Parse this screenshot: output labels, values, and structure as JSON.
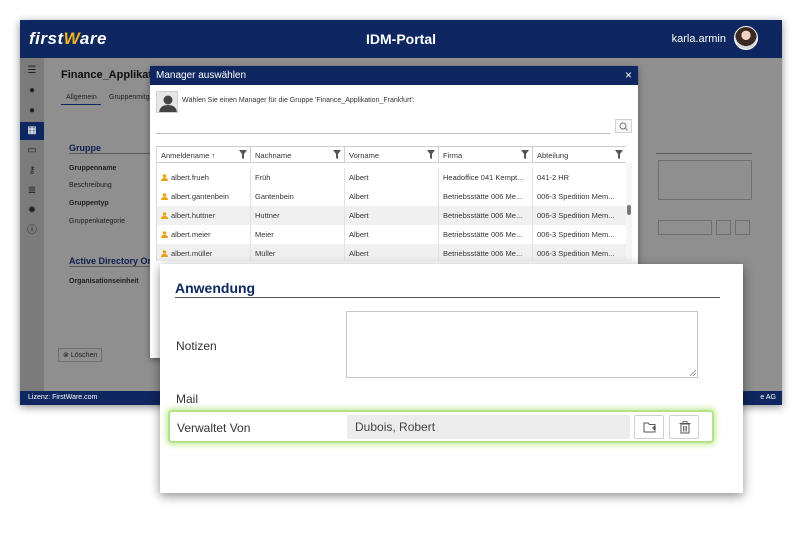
{
  "app": {
    "logo_text_a": "first",
    "logo_text_w": "W",
    "logo_text_b": "are",
    "portal_title": "IDM-Portal",
    "username": "karla.armin",
    "license": "Lizenz: FirstWare.com",
    "company_fragment": "e AG"
  },
  "background": {
    "page_title": "Finance_Applikatio",
    "tabs": [
      "Allgemein",
      "Gruppenmitgl"
    ],
    "section_group": "Gruppe",
    "label_groupname": "Gruppenname",
    "label_description": "Beschreibung",
    "label_grouptype": "Gruppentyp",
    "label_category": "Gruppenkategorie",
    "section_ad": "Active Directory Orga",
    "label_ou": "Organisationseinheit",
    "delete_button": "Löschen"
  },
  "dialog": {
    "title": "Manager auswählen",
    "close_label": "×",
    "prompt": "Wählen Sie einen Manager für die Gruppe 'Finance_Applikation_Frankfurt':",
    "search_value": "",
    "columns": [
      "Anmeldename ↑",
      "Nachname",
      "Vorname",
      "Firma",
      "Abteilung"
    ],
    "rows": [
      [
        "albert.frueh",
        "Früh",
        "Albert",
        "Headoffice 041 Kempt...",
        "041-2 HR"
      ],
      [
        "albert.gantenbein",
        "Gantenbein",
        "Albert",
        "Betriebsstätte 006 Me...",
        "006-3 Spedition Mem..."
      ],
      [
        "albert.huttner",
        "Huttner",
        "Albert",
        "Betriebsstätte 006 Me...",
        "006-3 Spedition Mem..."
      ],
      [
        "albert.meier",
        "Meier",
        "Albert",
        "Betriebsstätte 006 Me...",
        "006-3 Spedition Mem..."
      ],
      [
        "albert.müller",
        "Müller",
        "Albert",
        "Betriebsstätte 006 Me...",
        "006-3 Spedition Mem..."
      ]
    ]
  },
  "zoom": {
    "section_title": "Anwendung",
    "label_notes": "Notizen",
    "notes_value": "",
    "label_mail": "Mail",
    "label_managed_by": "Verwaltet Von",
    "managed_by_value": "Dubois, Robert"
  },
  "colors": {
    "header_navy": "#0f2760",
    "logo_accent": "#f0b51c",
    "highlight_green": "#b2e28a",
    "user_icon": "#e8a317"
  },
  "icons": [
    "menu-icon",
    "person-icon",
    "grid-icon",
    "settings-icon",
    "info-icon",
    "search-icon",
    "filter-icon",
    "user-icon",
    "folder-browse-icon",
    "trash-icon",
    "close-icon"
  ]
}
